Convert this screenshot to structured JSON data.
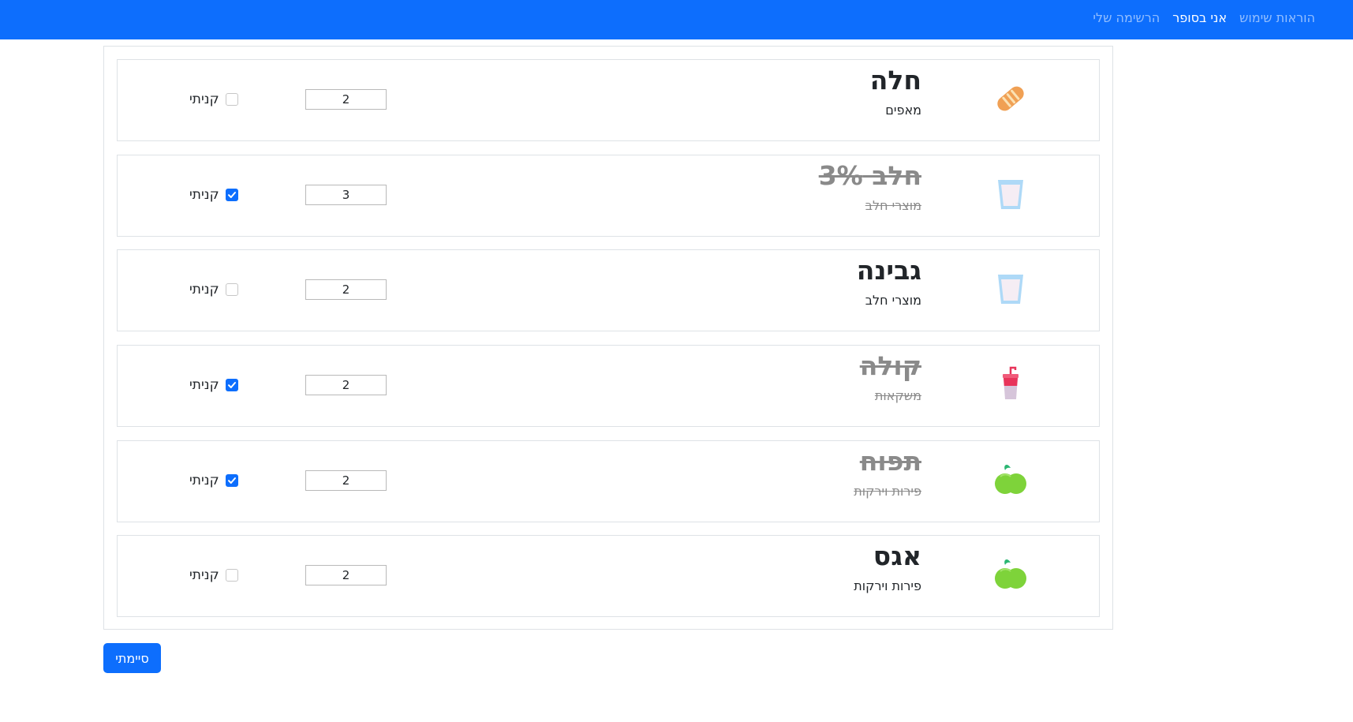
{
  "nav": {
    "links": [
      {
        "label": "הרשימה שלי",
        "active": false
      },
      {
        "label": "אני בסופר",
        "active": true
      },
      {
        "label": "הוראות שימוש",
        "active": false
      }
    ]
  },
  "items": [
    {
      "name": "חלה",
      "category": "מאפים",
      "quantity": "2",
      "bought_label": "קניתי",
      "bought": false,
      "icon": "bread-icon"
    },
    {
      "name": "חלב 3%",
      "category": "מוצרי חלב",
      "quantity": "3",
      "bought_label": "קניתי",
      "bought": true,
      "icon": "milk-glass-icon"
    },
    {
      "name": "גבינה",
      "category": "מוצרי חלב",
      "quantity": "2",
      "bought_label": "קניתי",
      "bought": false,
      "icon": "milk-glass-icon"
    },
    {
      "name": "קולה",
      "category": "משקאות",
      "quantity": "2",
      "bought_label": "קניתי",
      "bought": true,
      "icon": "soda-cup-icon"
    },
    {
      "name": "תפוח",
      "category": "פירות וירקות",
      "quantity": "2",
      "bought_label": "קניתי",
      "bought": true,
      "icon": "apple-icon"
    },
    {
      "name": "אגס",
      "category": "פירות וירקות",
      "quantity": "2",
      "bought_label": "קניתי",
      "bought": false,
      "icon": "apple-icon"
    }
  ],
  "footer": {
    "done_label": "סיימתי"
  },
  "colors": {
    "primary": "#0d6efd",
    "struck_text": "#8a8a8a"
  }
}
